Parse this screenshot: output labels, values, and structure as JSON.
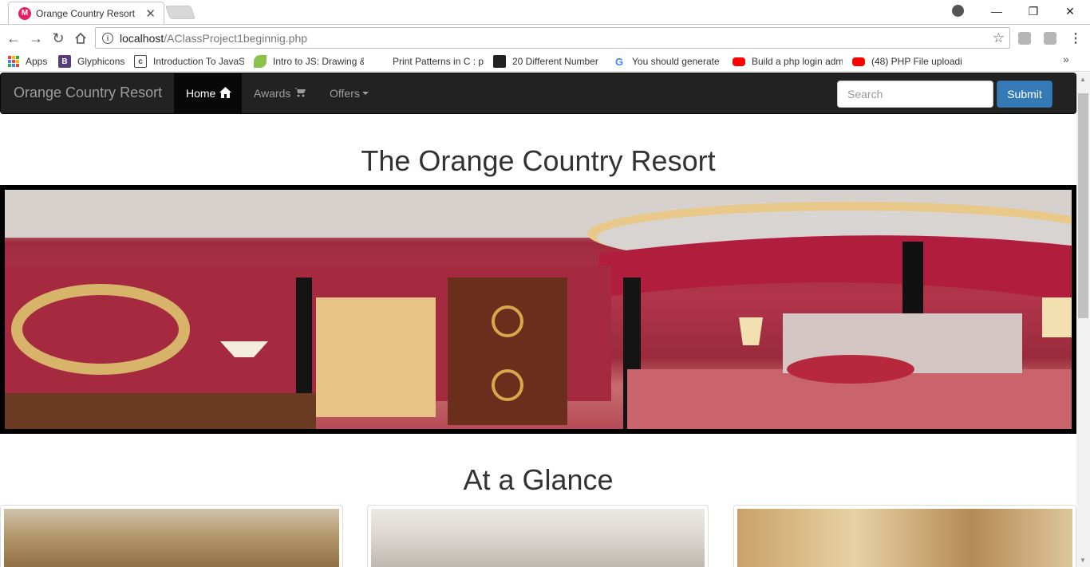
{
  "browser": {
    "tab_title": "Orange Country Resort",
    "tab_favicon_letter": "M",
    "url_host": "localhost",
    "url_path": "/AClassProject1beginnig.php"
  },
  "bookmarks": [
    {
      "label": "Apps",
      "icon": "apps-grid-icon"
    },
    {
      "label": "Glyphicons",
      "icon": "bootstrap-icon",
      "icon_text": "B",
      "color": "#563d7c"
    },
    {
      "label": "Introduction To JavaS",
      "icon": "code-icon",
      "icon_text": "c",
      "color": "#444444"
    },
    {
      "label": "Intro to JS: Drawing &",
      "icon": "leaf-icon",
      "color": "#8bc34a"
    },
    {
      "label": "Print Patterns in C : p",
      "icon": "blank-icon"
    },
    {
      "label": "20 Different Number",
      "icon": "terminal-icon",
      "color": "#222222"
    },
    {
      "label": "You should generate",
      "icon": "google-icon",
      "icon_text": "G",
      "color": "#4285f4"
    },
    {
      "label": "Build a php login adm",
      "icon": "youtube-icon",
      "color": "#ff0000"
    },
    {
      "label": "(48) PHP File uploadi",
      "icon": "youtube-icon",
      "color": "#ff0000"
    }
  ],
  "navbar": {
    "brand": "Orange Country Resort",
    "items": [
      {
        "label": "Home",
        "icon": "home-icon",
        "active": true
      },
      {
        "label": "Awards",
        "icon": "shopping-cart-icon",
        "active": false
      },
      {
        "label": "Offers",
        "icon": "caret-down-icon",
        "active": false
      }
    ],
    "search_placeholder": "Search",
    "submit_label": "Submit"
  },
  "main": {
    "title": "The Orange Country Resort",
    "section_title": "At a Glance"
  },
  "colors": {
    "navbar_bg": "#222222",
    "primary_button": "#337ab7",
    "heading": "#333333"
  }
}
